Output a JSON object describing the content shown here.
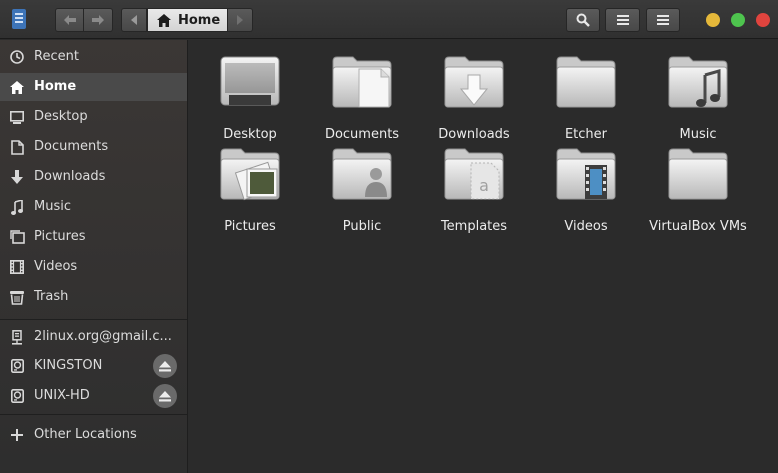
{
  "header": {
    "path_current": "Home"
  },
  "sidebar": {
    "places": [
      {
        "label": "Recent",
        "icon": "clock-icon",
        "active": false
      },
      {
        "label": "Home",
        "icon": "home-icon",
        "active": true
      },
      {
        "label": "Desktop",
        "icon": "desktop-icon",
        "active": false
      },
      {
        "label": "Documents",
        "icon": "document-icon",
        "active": false
      },
      {
        "label": "Downloads",
        "icon": "download-icon",
        "active": false
      },
      {
        "label": "Music",
        "icon": "music-icon",
        "active": false
      },
      {
        "label": "Pictures",
        "icon": "pictures-icon",
        "active": false
      },
      {
        "label": "Videos",
        "icon": "video-icon",
        "active": false
      },
      {
        "label": "Trash",
        "icon": "trash-icon",
        "active": false
      }
    ],
    "devices": [
      {
        "label": "2linux.org@gmail.c...",
        "icon": "network-drive-icon",
        "eject": false
      },
      {
        "label": "KINGSTON",
        "icon": "drive-icon",
        "eject": true
      },
      {
        "label": "UNIX-HD",
        "icon": "drive-icon",
        "eject": true
      }
    ],
    "other_locations": "Other Locations"
  },
  "files": [
    {
      "name": "Desktop",
      "icon": "desktop-folder-icon"
    },
    {
      "name": "Documents",
      "icon": "documents-folder-icon"
    },
    {
      "name": "Downloads",
      "icon": "downloads-folder-icon"
    },
    {
      "name": "Etcher",
      "icon": "folder-icon"
    },
    {
      "name": "Music",
      "icon": "music-folder-icon"
    },
    {
      "name": "Pictures",
      "icon": "pictures-folder-icon"
    },
    {
      "name": "Public",
      "icon": "public-folder-icon"
    },
    {
      "name": "Templates",
      "icon": "templates-folder-icon"
    },
    {
      "name": "Videos",
      "icon": "videos-folder-icon"
    },
    {
      "name": "VirtualBox VMs",
      "icon": "folder-icon"
    }
  ],
  "colors": {
    "window_min": "#e5b83a",
    "window_max": "#4ec44e",
    "window_close": "#e0443e",
    "active_row": "#4a4a4a"
  }
}
